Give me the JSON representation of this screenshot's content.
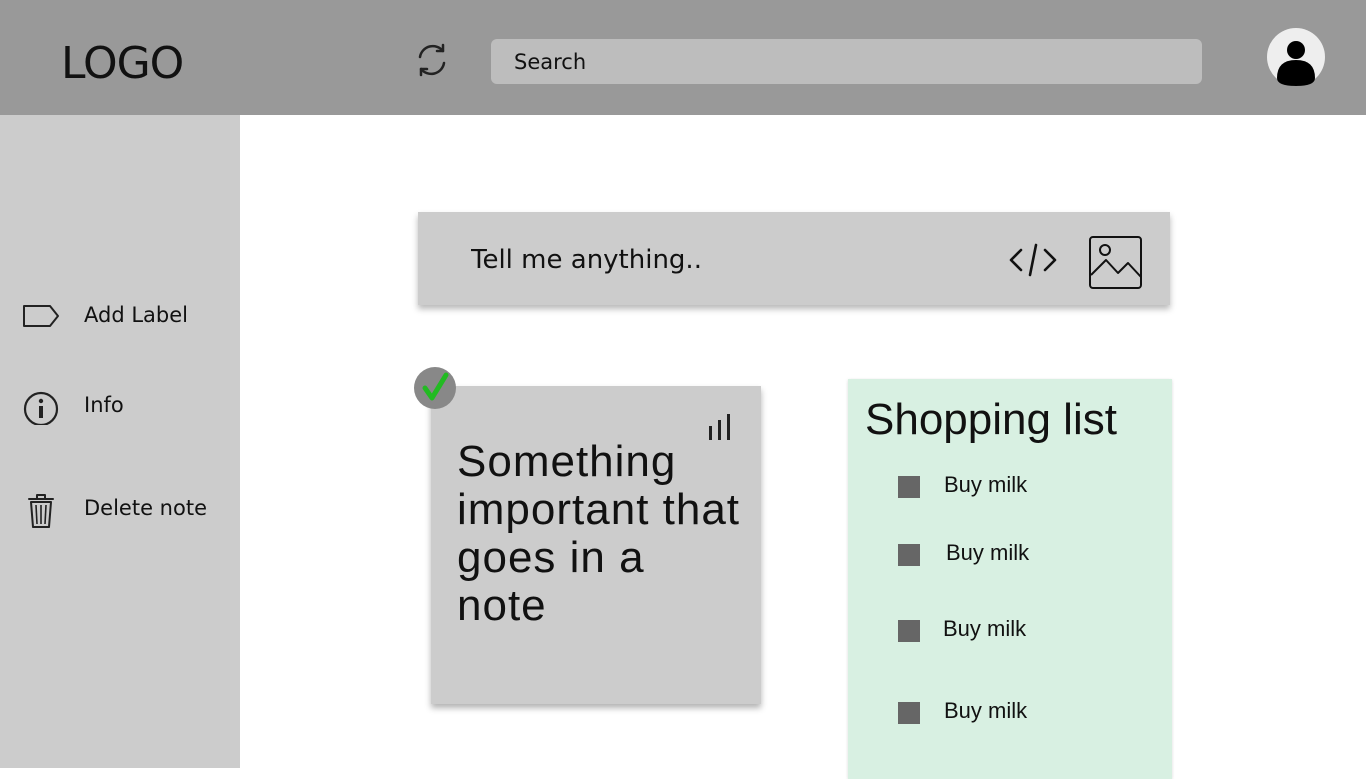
{
  "header": {
    "logo": "LOGO",
    "search_placeholder": "Search",
    "refresh_icon": "refresh-icon",
    "avatar_icon": "user-avatar-icon"
  },
  "sidebar": {
    "items": [
      {
        "label": "Add Label",
        "icon": "label-tag-icon"
      },
      {
        "label": "Info",
        "icon": "info-icon"
      },
      {
        "label": "Delete note",
        "icon": "trash-icon"
      }
    ]
  },
  "composer": {
    "placeholder": "Tell me anything..",
    "code_icon": "code-icon",
    "image_icon": "image-icon"
  },
  "note": {
    "text": "Something important that goes in a note",
    "checked": true,
    "check_color": "#22bb22"
  },
  "shopping_list": {
    "title": "Shopping list",
    "items": [
      "Buy milk",
      "Buy milk",
      "Buy milk",
      "Buy milk"
    ]
  },
  "colors": {
    "header_bg": "#999999",
    "sidebar_bg": "#cccccc",
    "card_bg": "#cccccc",
    "shopping_bg": "#d8f0e2"
  }
}
